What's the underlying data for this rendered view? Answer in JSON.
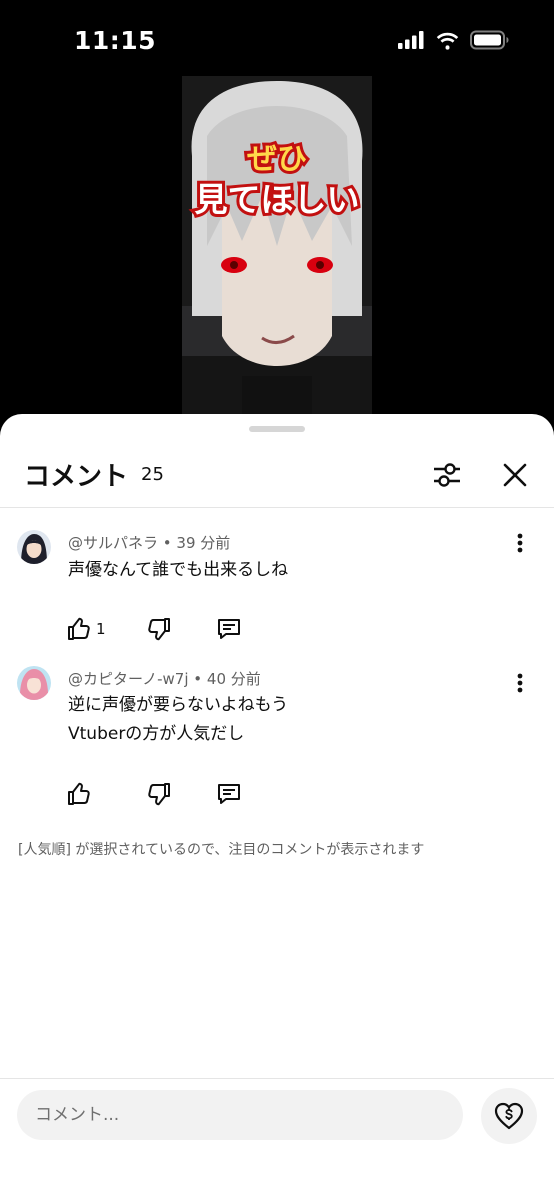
{
  "status_bar": {
    "time": "11:15",
    "icons": [
      "cellular-signal-icon",
      "wifi-icon",
      "battery-icon"
    ]
  },
  "video": {
    "overlay_line1": "ぜひ",
    "overlay_line2": "見てほしい"
  },
  "comments_panel": {
    "title": "コメント",
    "count": "25",
    "filter_icon": "sliders-icon",
    "close_icon": "close-icon",
    "comments": [
      {
        "author": "@サルパネラ",
        "time": "39 分前",
        "lines": [
          "声優なんて誰でも出来るしね"
        ],
        "like_count": "1"
      },
      {
        "author": "@カピターノ-w7j",
        "time": "40 分前",
        "lines": [
          "逆に声優が要らないよねもう",
          "Vtuberの方が人気だし"
        ],
        "like_count": ""
      }
    ],
    "sort_note": "[人気順] が選択されているので、注目のコメントが表示されます",
    "input_placeholder": "コメント...",
    "thanks_icon": "heart-dollar-icon"
  },
  "colors": {
    "sheet_background": "#ffffff",
    "secondary_text": "#606060",
    "input_background": "#f2f2f2"
  }
}
